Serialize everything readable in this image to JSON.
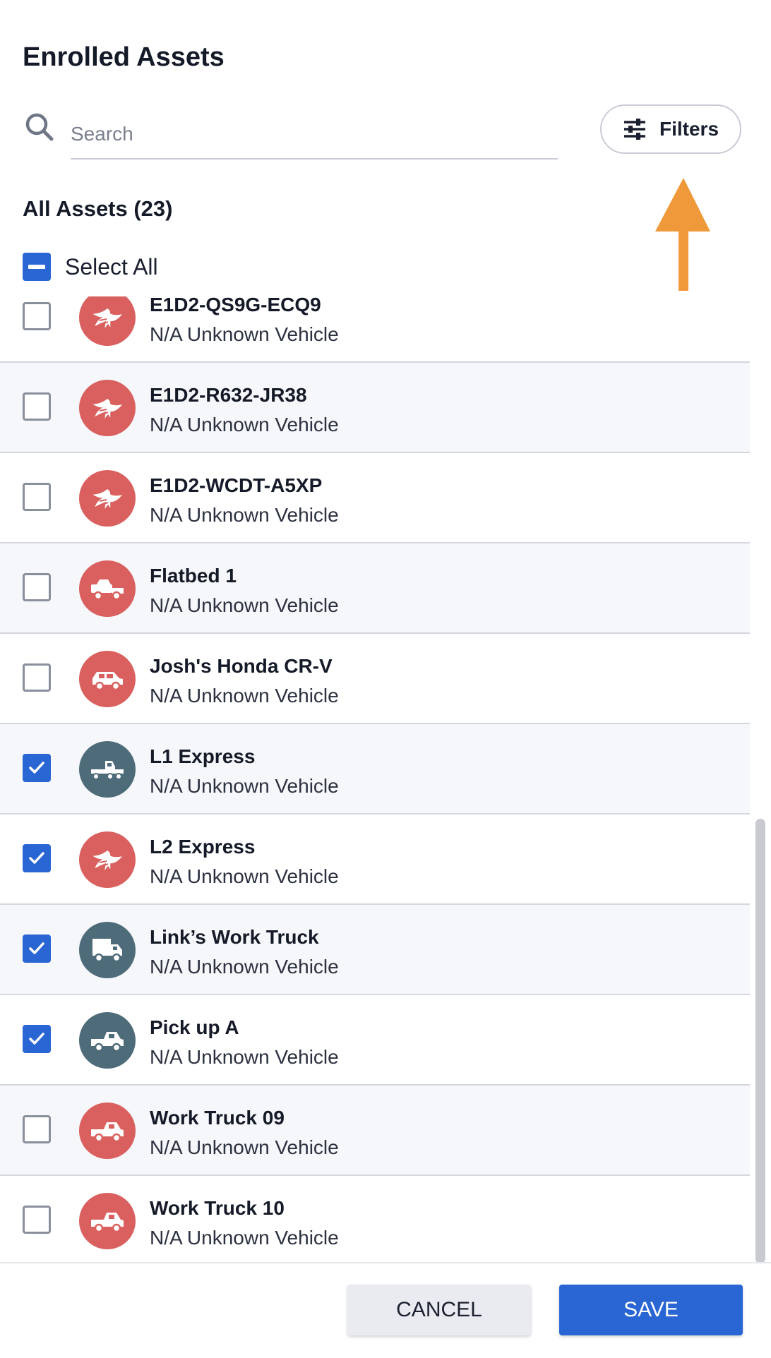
{
  "header": {
    "title": "Enrolled Assets"
  },
  "search": {
    "placeholder": "Search",
    "value": ""
  },
  "filters": {
    "label": "Filters"
  },
  "section": {
    "title": "All Assets (23)"
  },
  "select_all": {
    "label": "Select All",
    "state": "indeterminate"
  },
  "colors": {
    "accent": "#2a66d3",
    "avatar_red": "#d9605e",
    "avatar_slate": "#4e6b7a",
    "arrow": "#f0993a"
  },
  "assets": [
    {
      "name": "E1D2-QS9G-ECQ9",
      "subtitle": "N/A Unknown Vehicle",
      "checked": false,
      "icon": "eagle-icon",
      "color": "red"
    },
    {
      "name": "E1D2-R632-JR38",
      "subtitle": "N/A Unknown Vehicle",
      "checked": false,
      "icon": "eagle-icon",
      "color": "red"
    },
    {
      "name": "E1D2-WCDT-A5XP",
      "subtitle": "N/A Unknown Vehicle",
      "checked": false,
      "icon": "eagle-icon",
      "color": "red"
    },
    {
      "name": "Flatbed 1",
      "subtitle": "N/A Unknown Vehicle",
      "checked": false,
      "icon": "flatbed-truck-icon",
      "color": "red"
    },
    {
      "name": "Josh's Honda CR-V",
      "subtitle": "N/A Unknown Vehicle",
      "checked": false,
      "icon": "suv-icon",
      "color": "red"
    },
    {
      "name": "L1 Express",
      "subtitle": "N/A Unknown Vehicle",
      "checked": true,
      "icon": "semi-truck-icon",
      "color": "slate"
    },
    {
      "name": "L2 Express",
      "subtitle": "N/A Unknown Vehicle",
      "checked": true,
      "icon": "eagle-icon",
      "color": "red"
    },
    {
      "name": "Link’s Work Truck",
      "subtitle": "N/A Unknown Vehicle",
      "checked": true,
      "icon": "box-truck-icon",
      "color": "slate"
    },
    {
      "name": "Pick up A",
      "subtitle": "N/A Unknown Vehicle",
      "checked": true,
      "icon": "pickup-truck-icon",
      "color": "slate"
    },
    {
      "name": "Work Truck 09",
      "subtitle": "N/A Unknown Vehicle",
      "checked": false,
      "icon": "pickup-truck-icon",
      "color": "red"
    },
    {
      "name": "Work Truck 10",
      "subtitle": "N/A Unknown Vehicle",
      "checked": false,
      "icon": "pickup-truck-icon",
      "color": "red"
    }
  ],
  "footer": {
    "cancel_label": "CANCEL",
    "save_label": "SAVE"
  }
}
